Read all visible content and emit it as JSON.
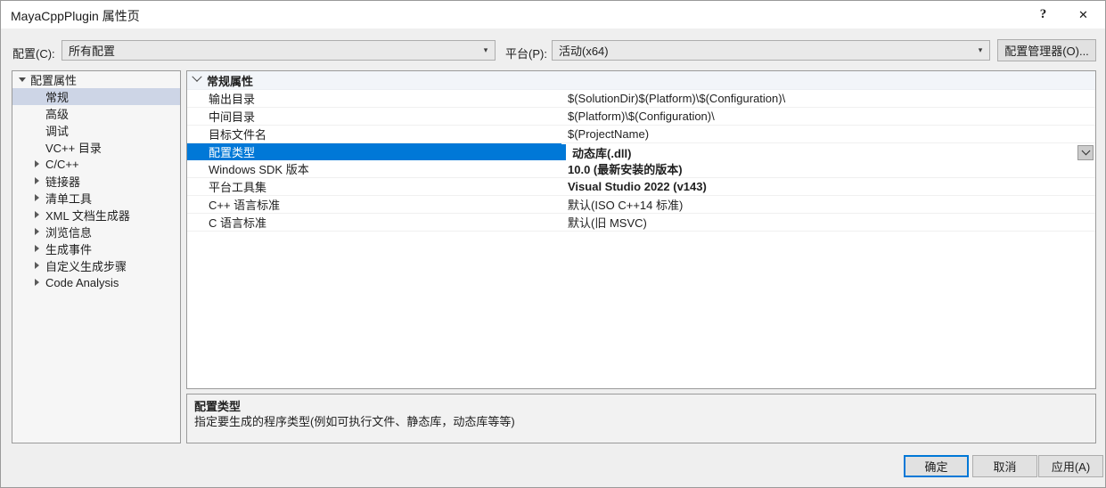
{
  "window": {
    "title": "MayaCppPlugin 属性页",
    "help_glyph": "?",
    "close_glyph": "✕"
  },
  "toolbar": {
    "configuration_label": "配置(C):",
    "configuration_value": "所有配置",
    "platform_label": "平台(P):",
    "platform_value": "活动(x64)",
    "config_manager_label": "配置管理器(O)..."
  },
  "sidebar": {
    "items": [
      {
        "label": "配置属性",
        "level": 0,
        "expander": "down",
        "selected": false
      },
      {
        "label": "常规",
        "level": 1,
        "expander": "none",
        "selected": true
      },
      {
        "label": "高级",
        "level": 1,
        "expander": "none",
        "selected": false
      },
      {
        "label": "调试",
        "level": 1,
        "expander": "none",
        "selected": false
      },
      {
        "label": "VC++ 目录",
        "level": 1,
        "expander": "none",
        "selected": false
      },
      {
        "label": "C/C++",
        "level": 1,
        "expander": "right",
        "selected": false
      },
      {
        "label": "链接器",
        "level": 1,
        "expander": "right",
        "selected": false
      },
      {
        "label": "清单工具",
        "level": 1,
        "expander": "right",
        "selected": false
      },
      {
        "label": "XML 文档生成器",
        "level": 1,
        "expander": "right",
        "selected": false
      },
      {
        "label": "浏览信息",
        "level": 1,
        "expander": "right",
        "selected": false
      },
      {
        "label": "生成事件",
        "level": 1,
        "expander": "right",
        "selected": false
      },
      {
        "label": "自定义生成步骤",
        "level": 1,
        "expander": "right",
        "selected": false
      },
      {
        "label": "Code Analysis",
        "level": 1,
        "expander": "right",
        "selected": false
      }
    ]
  },
  "grid": {
    "category": "常规属性",
    "rows": [
      {
        "name": "输出目录",
        "value": "$(SolutionDir)$(Platform)\\$(Configuration)\\",
        "bold": false,
        "selected": false
      },
      {
        "name": "中间目录",
        "value": "$(Platform)\\$(Configuration)\\",
        "bold": false,
        "selected": false
      },
      {
        "name": "目标文件名",
        "value": "$(ProjectName)",
        "bold": false,
        "selected": false
      },
      {
        "name": "配置类型",
        "value": "动态库(.dll)",
        "bold": true,
        "selected": true
      },
      {
        "name": "Windows SDK 版本",
        "value": "10.0 (最新安装的版本)",
        "bold": true,
        "selected": false
      },
      {
        "name": "平台工具集",
        "value": "Visual Studio 2022 (v143)",
        "bold": true,
        "selected": false
      },
      {
        "name": "C++ 语言标准",
        "value": "默认(ISO C++14 标准)",
        "bold": false,
        "selected": false
      },
      {
        "name": "C 语言标准",
        "value": "默认(旧 MSVC)",
        "bold": false,
        "selected": false
      }
    ]
  },
  "description": {
    "title": "配置类型",
    "text": "指定要生成的程序类型(例如可执行文件、静态库，动态库等等)"
  },
  "footer": {
    "ok_label": "确定",
    "cancel_label": "取消",
    "apply_label": "应用(A)"
  },
  "colors": {
    "accent": "#0078D7",
    "dialog_bg": "#EFEFEF",
    "tree_selection": "#CDD5E6",
    "category_bg": "#F2F5F9"
  }
}
